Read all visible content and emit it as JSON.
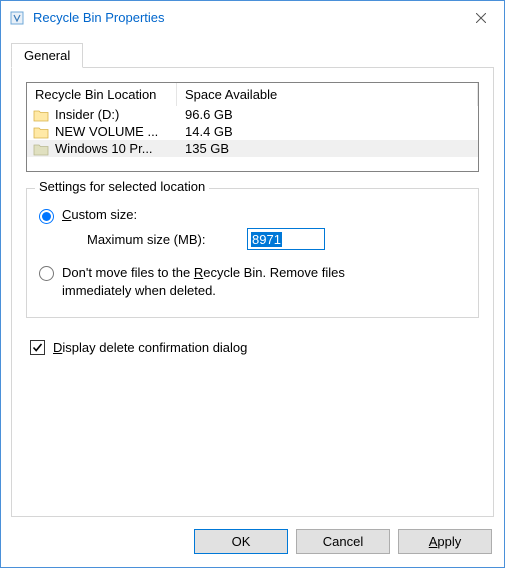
{
  "window": {
    "title": "Recycle Bin Properties"
  },
  "tab": {
    "label": "General"
  },
  "list": {
    "headers": {
      "col1": "Recycle Bin Location",
      "col2": "Space Available"
    },
    "rows": [
      {
        "name": "Insider (D:)",
        "space": "96.6 GB",
        "selected": false
      },
      {
        "name": "NEW VOLUME ...",
        "space": "14.4 GB",
        "selected": false
      },
      {
        "name": "Windows 10 Pr...",
        "space": "135 GB",
        "selected": true
      }
    ]
  },
  "group": {
    "legend": "Settings for selected location",
    "custom_prefix": "C",
    "custom_rest": "ustom size:",
    "max_label": "Maximum size (MB):",
    "max_value": "8971",
    "dont_prefix": "Don't move files to the ",
    "dont_ul": "R",
    "dont_mid": "ecycle Bin. Remove files immediately when deleted."
  },
  "checkbox": {
    "ul": "D",
    "rest": "isplay delete confirmation dialog",
    "checked": true
  },
  "buttons": {
    "ok": "OK",
    "cancel": "Cancel",
    "apply_ul": "A",
    "apply_rest": "pply"
  }
}
